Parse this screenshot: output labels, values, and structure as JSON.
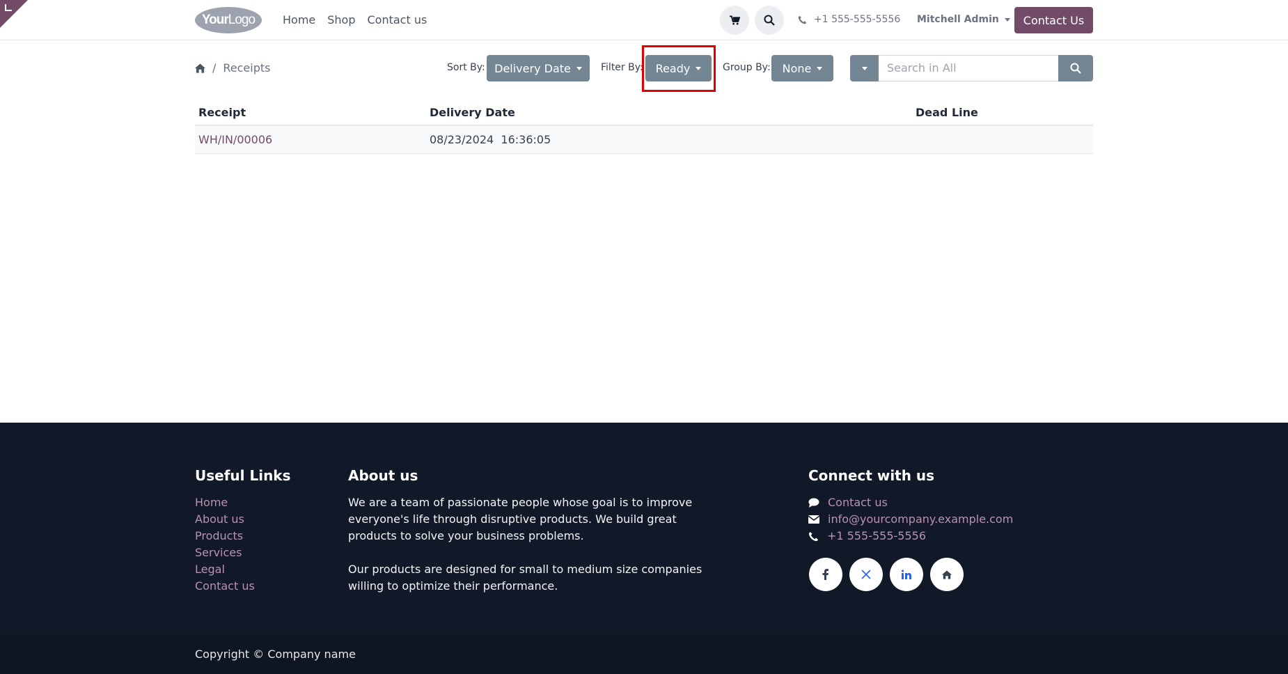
{
  "header": {
    "logo_bold": "Your",
    "logo_light": "Logo",
    "nav": [
      "Home",
      "Shop",
      "Contact us"
    ],
    "phone": "+1 555-555-5556",
    "user": "Mitchell Admin",
    "contact_button": "Contact Us"
  },
  "toolbar": {
    "breadcrumb": "Receipts",
    "sort_label": "Sort By:",
    "sort_value": "Delivery Date",
    "filter_label": "Filter By:",
    "filter_value": "Ready",
    "group_label": "Group By:",
    "group_value": "None",
    "search_placeholder": "Search in All"
  },
  "table": {
    "columns": [
      "Receipt",
      "Delivery Date",
      "Dead Line"
    ],
    "rows": [
      [
        "WH/IN/00006",
        "08/23/2024  16:36:05",
        ""
      ]
    ]
  },
  "footer": {
    "useful_title": "Useful Links",
    "useful_links": [
      "Home",
      "About us",
      "Products",
      "Services",
      "Legal",
      "Contact us"
    ],
    "about_title": "About us",
    "about_p1": "We are a team of passionate people whose goal is to improve everyone's life through disruptive products. We build great products to solve your business problems.",
    "about_p2": "Our products are designed for small to medium size companies willing to optimize their performance.",
    "connect_title": "Connect with us",
    "connect_contact": "Contact us",
    "connect_email": "info@yourcompany.example.com",
    "connect_phone": "+1 555-555-5556",
    "social_icons": [
      "facebook-icon",
      "x-twitter-icon",
      "linkedin-icon",
      "home-icon"
    ],
    "copyright": "Copyright © Company name"
  },
  "colors": {
    "brand": "#714b67",
    "secondary_button": "#748694",
    "footer_bg": "#111827",
    "highlight": "#e30000"
  }
}
